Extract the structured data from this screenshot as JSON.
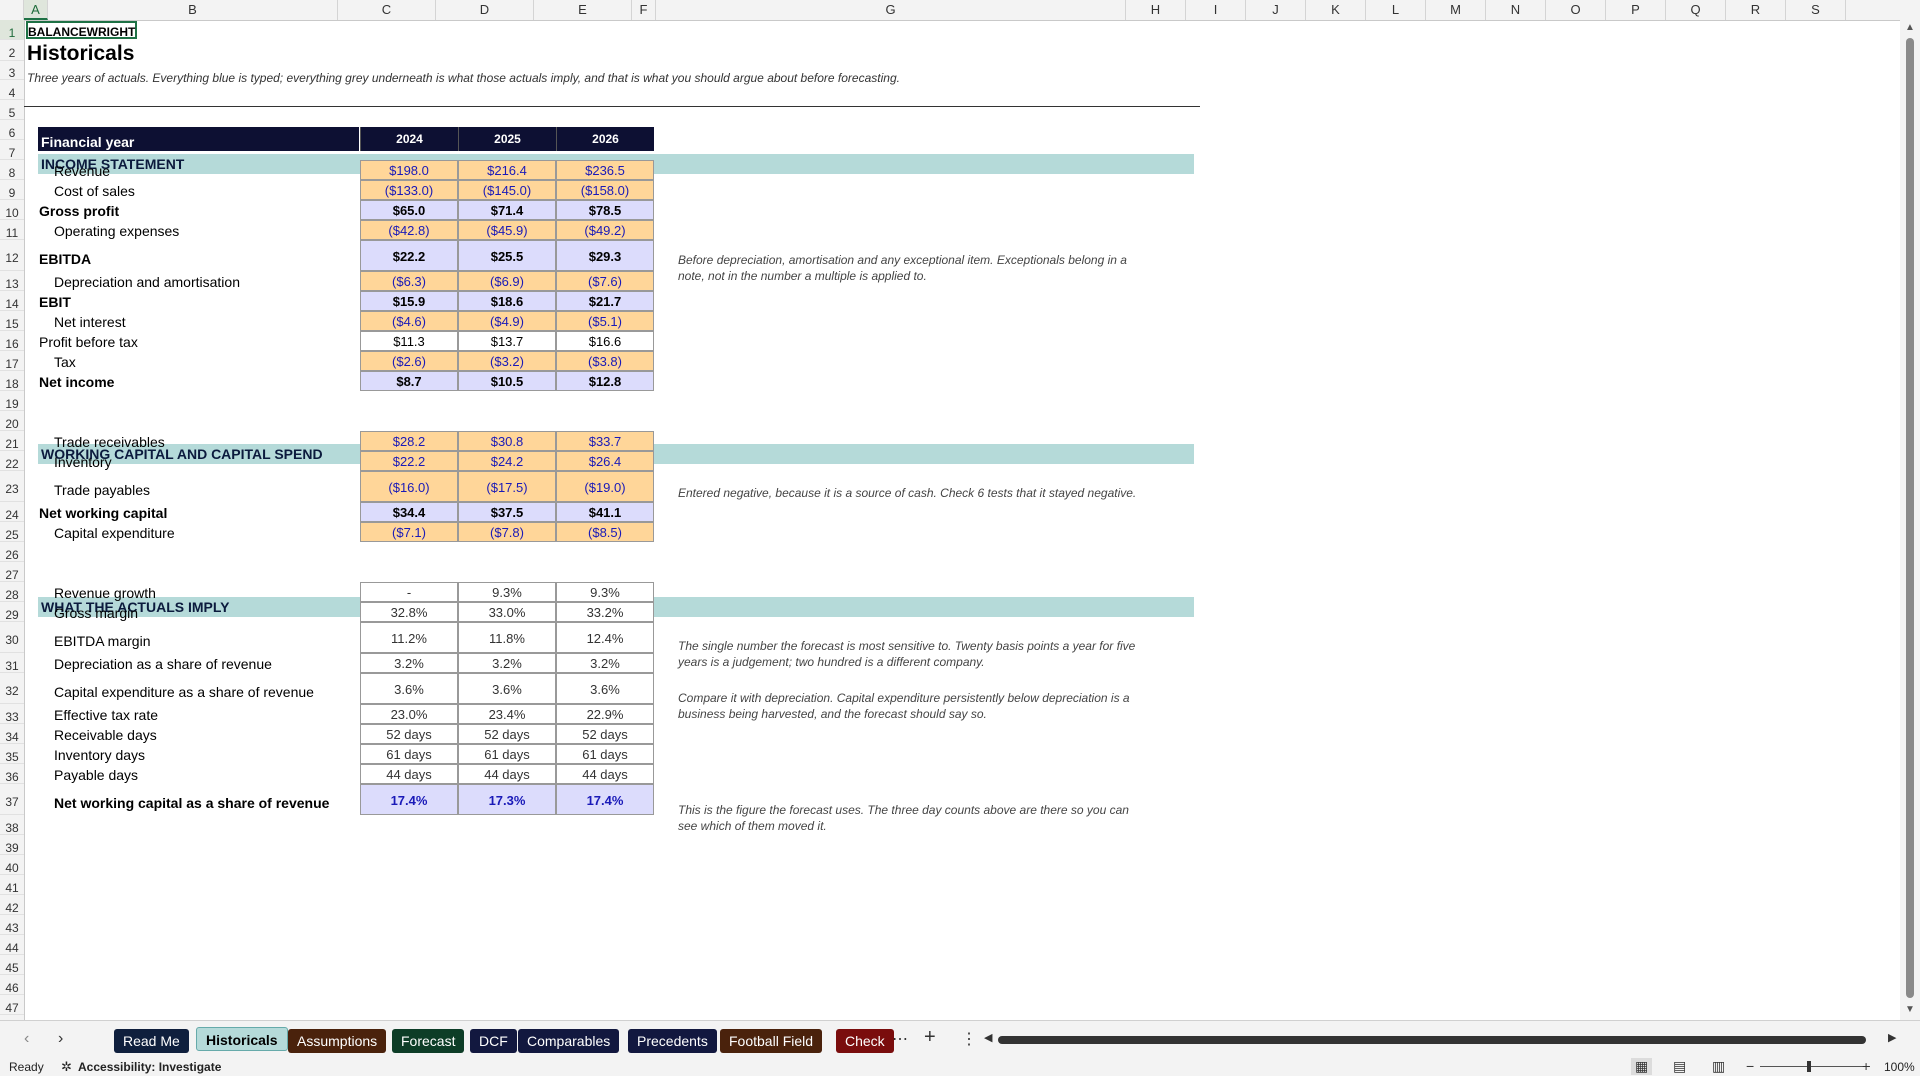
{
  "columns": [
    "A",
    "B",
    "C",
    "D",
    "E",
    "F",
    "G",
    "H",
    "I",
    "J",
    "K",
    "L",
    "M",
    "N",
    "O",
    "P",
    "Q",
    "R",
    "S"
  ],
  "brand": "BALANCEWRIGHT",
  "title": "Historicals",
  "subtitle": "Three years of actuals. Everything blue is typed; everything grey underneath is what those actuals imply, and that is what you should argue about before forecasting.",
  "header": {
    "label": "Financial year",
    "years": [
      "2024",
      "2025",
      "2026"
    ]
  },
  "sections": {
    "income": "INCOME STATEMENT",
    "wc": "WORKING CAPITAL AND CAPITAL SPEND",
    "implied": "WHAT THE ACTUALS IMPLY"
  },
  "income_rows": [
    {
      "label": "Revenue",
      "values": [
        "$198.0",
        "$216.4",
        "$236.5"
      ]
    },
    {
      "label": "Cost of sales",
      "values": [
        "($133.0)",
        "($145.0)",
        "($158.0)"
      ]
    },
    {
      "label": "Gross profit",
      "values": [
        "$65.0",
        "$71.4",
        "$78.5"
      ]
    },
    {
      "label": "Operating expenses",
      "values": [
        "($42.8)",
        "($45.9)",
        "($49.2)"
      ]
    },
    {
      "label": "EBITDA",
      "values": [
        "$22.2",
        "$25.5",
        "$29.3"
      ]
    },
    {
      "label": "Depreciation and amortisation",
      "values": [
        "($6.3)",
        "($6.9)",
        "($7.6)"
      ]
    },
    {
      "label": "EBIT",
      "values": [
        "$15.9",
        "$18.6",
        "$21.7"
      ]
    },
    {
      "label": "Net interest",
      "values": [
        "($4.6)",
        "($4.9)",
        "($5.1)"
      ]
    },
    {
      "label": "Profit before tax",
      "values": [
        "$11.3",
        "$13.7",
        "$16.6"
      ]
    },
    {
      "label": "Tax",
      "values": [
        "($2.6)",
        "($3.2)",
        "($3.8)"
      ]
    },
    {
      "label": "Net income",
      "values": [
        "$8.7",
        "$10.5",
        "$12.8"
      ]
    }
  ],
  "wc_rows": [
    {
      "label": "Trade receivables",
      "values": [
        "$28.2",
        "$30.8",
        "$33.7"
      ]
    },
    {
      "label": "Inventory",
      "values": [
        "$22.2",
        "$24.2",
        "$26.4"
      ]
    },
    {
      "label": "Trade payables",
      "values": [
        "($16.0)",
        "($17.5)",
        "($19.0)"
      ]
    },
    {
      "label": "Net working capital",
      "values": [
        "$34.4",
        "$37.5",
        "$41.1"
      ]
    },
    {
      "label": "Capital expenditure",
      "values": [
        "($7.1)",
        "($7.8)",
        "($8.5)"
      ]
    }
  ],
  "implied_rows": [
    {
      "label": "Revenue growth",
      "values": [
        "-",
        "9.3%",
        "9.3%"
      ]
    },
    {
      "label": "Gross margin",
      "values": [
        "32.8%",
        "33.0%",
        "33.2%"
      ]
    },
    {
      "label": "EBITDA margin",
      "values": [
        "11.2%",
        "11.8%",
        "12.4%"
      ]
    },
    {
      "label": "Depreciation as a share of revenue",
      "values": [
        "3.2%",
        "3.2%",
        "3.2%"
      ]
    },
    {
      "label": "Capital expenditure as a share of revenue",
      "values": [
        "3.6%",
        "3.6%",
        "3.6%"
      ]
    },
    {
      "label": "Effective tax rate",
      "values": [
        "23.0%",
        "23.4%",
        "22.9%"
      ]
    },
    {
      "label": "Receivable days",
      "values": [
        "52 days",
        "52 days",
        "52 days"
      ]
    },
    {
      "label": "Inventory days",
      "values": [
        "61 days",
        "61 days",
        "61 days"
      ]
    },
    {
      "label": "Payable days",
      "values": [
        "44 days",
        "44 days",
        "44 days"
      ]
    },
    {
      "label": "Net working capital as a share of revenue",
      "values": [
        "17.4%",
        "17.3%",
        "17.4%"
      ]
    }
  ],
  "notes": {
    "ebitda": "Before depreciation, amortisation and any exceptional item. Exceptionals belong in a note, not in the number a multiple is applied to.",
    "payables": "Entered negative, because it is a source of cash. Check 6 tests that it stayed negative.",
    "ebitda_margin": "The single number the forecast is most sensitive to. Twenty basis points a year for five years is a judgement; two hundred is a different company.",
    "capex": "Compare it with depreciation. Capital expenditure persistently below depreciation is a business being harvested, and the forecast should say so.",
    "nwc": "This is the figure the forecast uses. The three day counts above are there so you can see which of them moved it."
  },
  "tabs": [
    {
      "label": "Read Me",
      "color": "#0f1f3d"
    },
    {
      "label": "Historicals",
      "color": "#b5dad9",
      "active": true
    },
    {
      "label": "Assumptions",
      "color": "#4a220c"
    },
    {
      "label": "Forecast",
      "color": "#0d3d27"
    },
    {
      "label": "DCF",
      "color": "#12183f"
    },
    {
      "label": "Comparables",
      "color": "#12183f"
    },
    {
      "label": "Precedents",
      "color": "#12183f"
    },
    {
      "label": "Football Field",
      "color": "#4a220c"
    },
    {
      "label": "Check",
      "color": "#7a0d0d"
    }
  ],
  "status": {
    "ready": "Ready",
    "accessibility": "Accessibility: Investigate",
    "zoom": "100%"
  }
}
